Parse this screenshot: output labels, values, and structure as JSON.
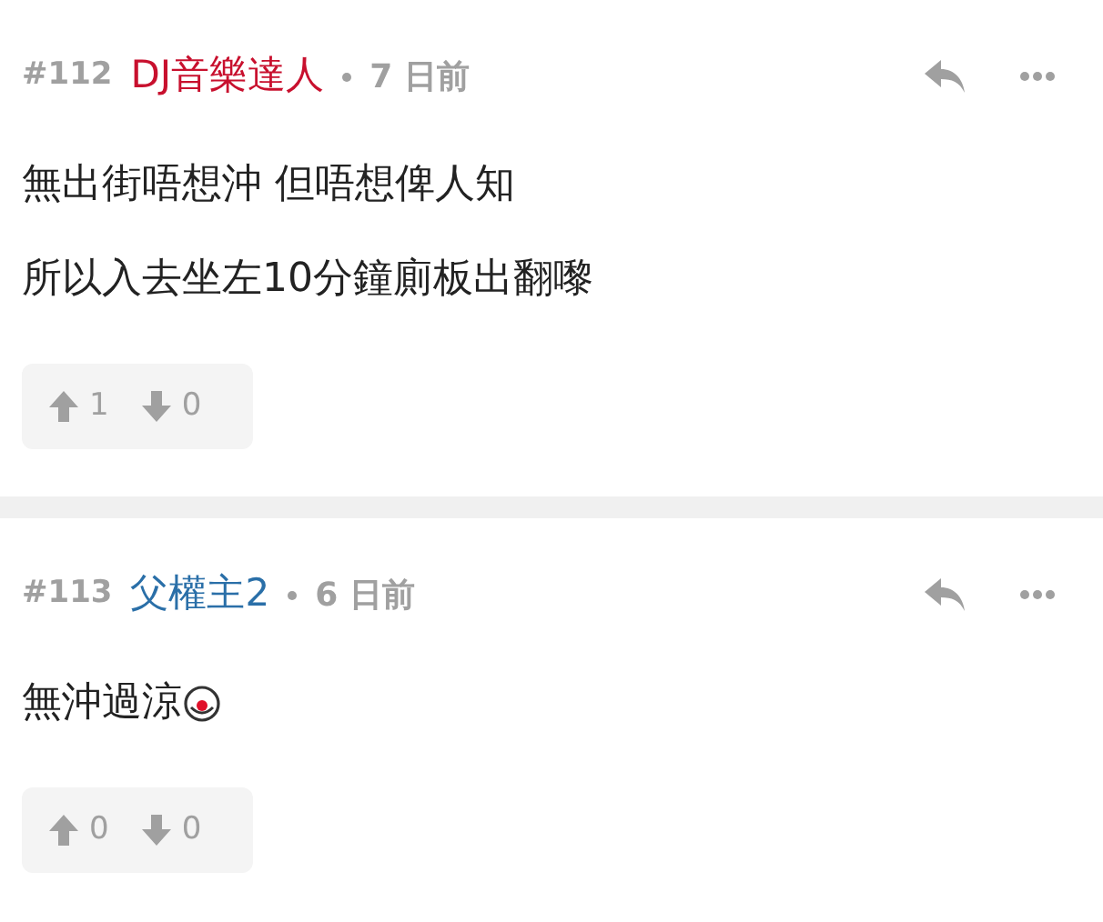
{
  "posts": [
    {
      "number": "#112",
      "author": "DJ音樂達人",
      "color": "#c8102e",
      "time": "7 日前",
      "lines": [
        "無出街唔想沖 但唔想俾人知",
        "所以入去坐左10分鐘廁板出翻嚟"
      ],
      "emoji": false,
      "upvotes": "1",
      "downvotes": "0"
    },
    {
      "number": "#113",
      "author": "父權主2",
      "color": "#2a6fa8",
      "time": "6 日前",
      "lines": [
        "無沖過涼"
      ],
      "emoji": true,
      "upvotes": "0",
      "downvotes": "0"
    }
  ]
}
